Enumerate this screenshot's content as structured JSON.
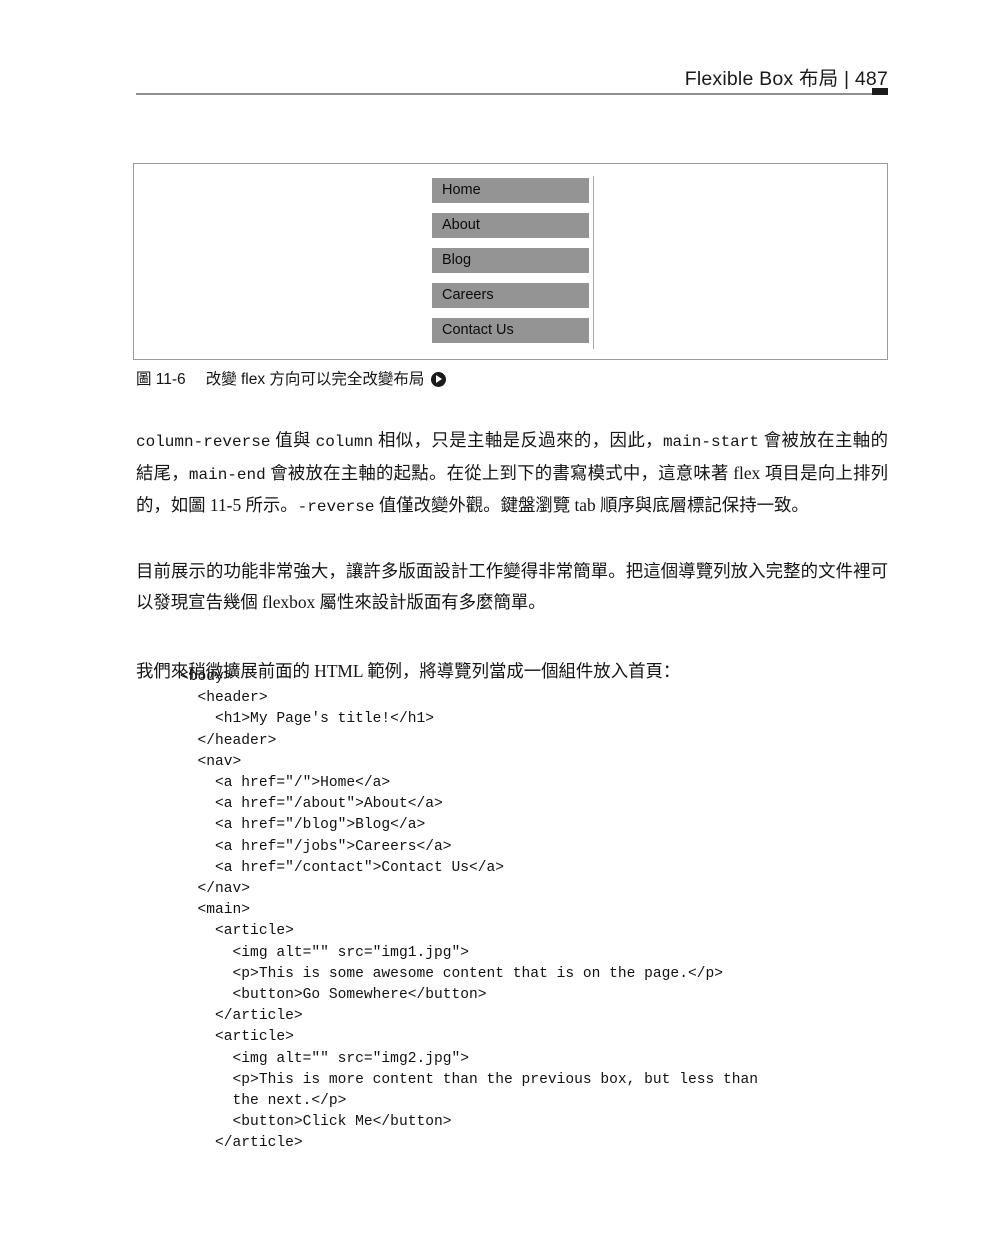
{
  "page_header": {
    "title": "Flexible Box 布局 | 487"
  },
  "figure": {
    "nav_buttons": [
      {
        "label": "Home"
      },
      {
        "label": "About"
      },
      {
        "label": "Blog"
      },
      {
        "label": "Careers"
      },
      {
        "label": "Contact Us"
      }
    ]
  },
  "caption": {
    "label": "圖 11-6",
    "text": "改變 flex 方向可以完全改變布局",
    "icon": "play-circle-icon"
  },
  "paragraphs": {
    "p1_part1": "column-reverse",
    "p1_part2": " 值與 ",
    "p1_part3": "column",
    "p1_part4": " 相似，只是主軸是反過來的，因此，",
    "p1_part5": "main-start",
    "p1_part6": " 會被放在主軸的結尾，",
    "p1_part7": "main-end",
    "p1_part8": " 會被放在主軸的起點。在從上到下的書寫模式中，這意味著 flex 項目是向上排列的，如圖 11-5 所示。",
    "p1_part9": "-reverse",
    "p1_part10": " 值僅改變外觀。鍵盤瀏覽 tab 順序與底層標記保持一致。",
    "p2": "目前展示的功能非常強大，讓許多版面設計工作變得非常簡單。把這個導覽列放入完整的文件裡可以發現宣告幾個 flexbox 屬性來設計版面有多麼簡單。",
    "p3": "我們來稍微擴展前面的 HTML 範例，將導覽列當成一個組件放入首頁："
  },
  "code": {
    "content": "<body>\n  <header>\n    <h1>My Page's title!</h1>\n  </header>\n  <nav>\n    <a href=\"/\">Home</a>\n    <a href=\"/about\">About</a>\n    <a href=\"/blog\">Blog</a>\n    <a href=\"/jobs\">Careers</a>\n    <a href=\"/contact\">Contact Us</a>\n  </nav>\n  <main>\n    <article>\n      <img alt=\"\" src=\"img1.jpg\">\n      <p>This is some awesome content that is on the page.</p>\n      <button>Go Somewhere</button>\n    </article>\n    <article>\n      <img alt=\"\" src=\"img2.jpg\">\n      <p>This is more content than the previous box, but less than\n      the next.</p>\n      <button>Click Me</button>\n    </article>"
  },
  "colors": {
    "nav_button_bg": "#949494",
    "figure_border": "#9a9a9a",
    "rule": "#8e8e8e",
    "text": "#151515"
  }
}
